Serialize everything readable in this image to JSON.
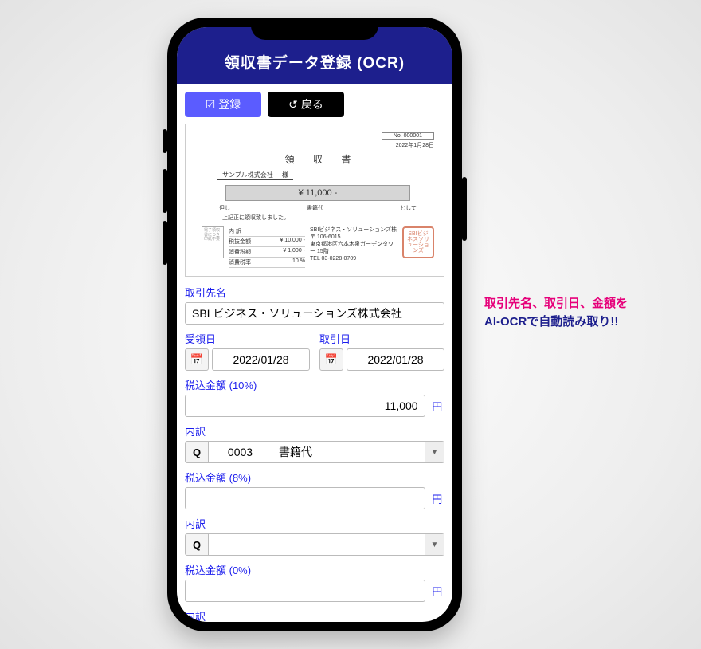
{
  "header": {
    "title": "領収書データ登録 (OCR)"
  },
  "toolbar": {
    "register_label": "登録",
    "back_label": "戻る"
  },
  "receipt": {
    "no_label": "No.",
    "no_value": "000001",
    "date": "2022年1月28日",
    "title": "領 収 書",
    "to": "サンプル株式会社",
    "to_suffix": "様",
    "amount": "¥  11,000  -",
    "tadashi": "但し",
    "shosekidai": "書籍代",
    "toshite": "として",
    "note": "上記正に領収致しました。",
    "stampbox": "電子領収書につき印紙不要",
    "bt_col": "内 訳",
    "r1a": "税抜金額",
    "r1b": "¥ 10,000 -",
    "r2a": "消費税額",
    "r2b": "¥ 1,000 -",
    "r3a": "消費税率",
    "r3b": "10 %",
    "issuer_name": "SBIビジネス・ソリューションズ株",
    "issuer_zip": "〒 106-6015",
    "issuer_addr": "東京都港区六本木泉ガーデンタワー 15階",
    "issuer_tel": "TEL 03-0228-0709",
    "seal": "SBIビジネスソリューションズ"
  },
  "form": {
    "partner_label": "取引先名",
    "partner_value": "SBI ビジネス・ソリューションズ株式会社",
    "receive_date_label": "受領日",
    "receive_date_value": "2022/01/28",
    "txn_date_label": "取引日",
    "txn_date_value": "2022/01/28",
    "amount10_label": "税込金額 (10%)",
    "amount10_value": "11,000",
    "yen": "円",
    "breakdown_label": "内訳",
    "breakdown10_code": "0003",
    "breakdown10_text": "書籍代",
    "amount8_label": "税込金額 (8%)",
    "amount8_value": "",
    "breakdown8_code": "",
    "breakdown8_text": "",
    "amount0_label": "税込金額 (0%)",
    "amount0_value": ""
  },
  "callout": {
    "line1": "取引先名、取引日、金額を",
    "line2": "AI-OCRで自動読み取り!!"
  }
}
